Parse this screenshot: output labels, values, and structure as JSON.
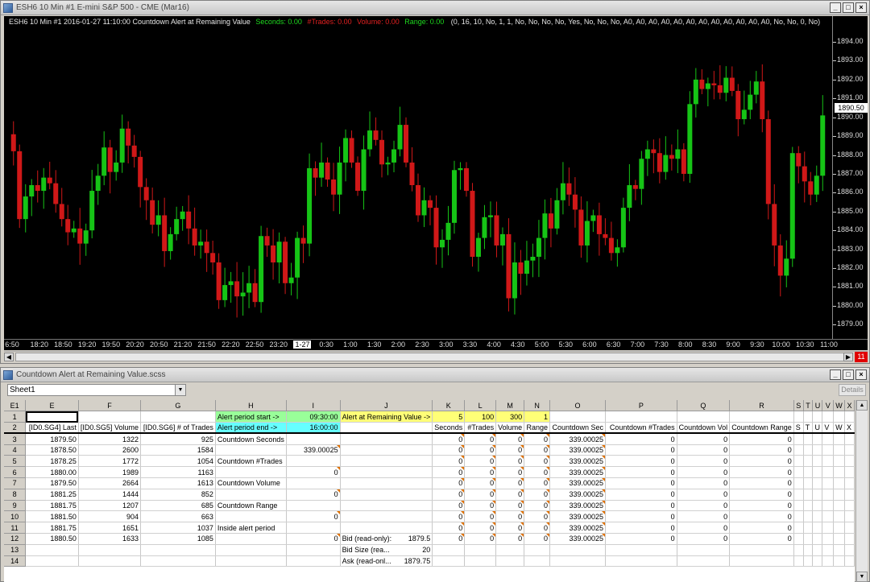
{
  "chart_window": {
    "title": "ESH6  10 Min  #1  E-mini S&P 500 - CME (Mar16)",
    "status_line": "ESH6  10 Min  #1 2016-01-27 11:10:00  Countdown Alert at Remaining Value",
    "status_seconds": "Seconds: 0.00",
    "status_trades": "#Trades: 0.00",
    "status_volume": "Volume: 0.00",
    "status_range": "Range: 0.00",
    "status_params": "(0, 16, 10, No, 1, 1, No, No, No, No, Yes, No, No, No, A0, A0, A0, A0, A0, A0, A0, A0, A0, A0, A0, A0, No, No, 0, No)",
    "current_price": "1890.50",
    "red_badge": "11",
    "colors": {
      "up": "#16c416",
      "down": "#d01818",
      "bg": "#000000",
      "status_green": "#1ed81e",
      "status_red": "#e02020"
    }
  },
  "chart_data": {
    "type": "candlestick",
    "ylim": [
      1878.5,
      1894.6
    ],
    "y_ticks": [
      "1894.00",
      "1893.00",
      "1892.00",
      "1891.00",
      "1890.00",
      "1889.00",
      "1888.00",
      "1887.00",
      "1886.00",
      "1885.00",
      "1884.00",
      "1883.00",
      "1882.00",
      "1881.00",
      "1880.00",
      "1879.00"
    ],
    "x_ticks": [
      "6:50",
      "18:20",
      "18:50",
      "19:20",
      "19:50",
      "20:20",
      "20:50",
      "21:20",
      "21:50",
      "22:20",
      "22:50",
      "23:20",
      "1-27",
      "0:30",
      "1:00",
      "1:30",
      "2:00",
      "2:30",
      "3:00",
      "3:30",
      "4:00",
      "4:30",
      "5:00",
      "5:30",
      "6:00",
      "6:30",
      "7:00",
      "7:30",
      "8:00",
      "8:30",
      "9:00",
      "9:30",
      "10:00",
      "10:30",
      "11:00"
    ],
    "highlight_tick": "1-27",
    "closes": [
      1888.2,
      1884.6,
      1885.8,
      1886.4,
      1886.1,
      1886.8,
      1886.5,
      1885.4,
      1884.6,
      1883.9,
      1884.1,
      1883.3,
      1884.0,
      1886.1,
      1886.9,
      1888.4,
      1887.1,
      1887.6,
      1889.4,
      1888.5,
      1887.9,
      1886.3,
      1885.6,
      1884.3,
      1884.8,
      1882.9,
      1883.8,
      1884.6,
      1885.0,
      1884.1,
      1883.2,
      1883.4,
      1882.8,
      1882.3,
      1880.3,
      1881.1,
      1881.3,
      1880.5,
      1880.7,
      1881.2,
      1880.2,
      1883.7,
      1883.2,
      1882.3,
      1883.4,
      1881.2,
      1881.5,
      1883.6,
      1883.3,
      1887.3,
      1886.8,
      1887.6,
      1886.7,
      1885.9,
      1887.6,
      1888.9,
      1887.6,
      1886.1,
      1888.3,
      1889.3,
      1888.8,
      1887.5,
      1887.6,
      1888.3,
      1889.6,
      1887.6,
      1886.4,
      1884.8,
      1885.6,
      1885.2,
      1883.1,
      1883.5,
      1884.4,
      1887.2,
      1887.3,
      1886.1,
      1882.6,
      1883.6,
      1884.7,
      1884.8,
      1883.2,
      1883.8,
      1880.4,
      1882.3,
      1881.7,
      1882.4,
      1882.6,
      1883.6,
      1884.9,
      1884.1,
      1885.6,
      1886.5,
      1885.9,
      1885.1,
      1883.2,
      1884.5,
      1884.8,
      1883.8,
      1883.6,
      1882.8,
      1883.1,
      1885.2,
      1886.4,
      1886.2,
      1887.8,
      1888.3,
      1888.1,
      1887.1,
      1888.0,
      1887.8,
      1888.3,
      1887.0,
      1890.7,
      1892.0,
      1891.5,
      1891.8,
      1891.7,
      1891.3,
      1892.1,
      1891.4,
      1889.9,
      1890.4,
      1891.2,
      1891.9,
      1889.9,
      1885.4,
      1883.2,
      1881.6,
      1882.5,
      1888.1,
      1887.4,
      1886.6,
      1885.9,
      1886.9,
      1890.1
    ],
    "bar_count": 136
  },
  "sheet_window": {
    "title": "Countdown Alert at Remaining Value.scss",
    "sheet_name": "Sheet1",
    "cell_ref": "E1",
    "details_label": "Details"
  },
  "spreadsheet": {
    "columns": [
      "E",
      "F",
      "G",
      "H",
      "I",
      "J",
      "K",
      "L",
      "M",
      "N",
      "O",
      "P",
      "Q",
      "R",
      "S",
      "T",
      "U",
      "V",
      "W",
      "X"
    ],
    "row1": {
      "h": "Alert period start ->",
      "i": "09:30:00",
      "j": "Alert at Remaining Value ->",
      "k": "5",
      "l": "100",
      "m": "300",
      "n": "1"
    },
    "row2": {
      "e": "[ID0.SG4] Last",
      "f": "[ID0.SG5] Volume",
      "g": "[ID0.SG6]  # of Trades",
      "h": "Alert period end ->",
      "i": "16:00:00",
      "k": "Seconds",
      "l": "#Trades",
      "m": "Volume",
      "n": "Range",
      "o": "Countdown Sec",
      "p": "Countdown #Trades",
      "q": "Countdown Vol",
      "r": "Countdown Range",
      "s": "S",
      "t": "T",
      "u": "U",
      "v": "V",
      "w": "W",
      "x": "X"
    },
    "data_rows": [
      {
        "row": "3",
        "e": "1879.50",
        "f": "1322",
        "g": "925",
        "h": "Countdown Seconds",
        "i": "",
        "j": "",
        "k": "0",
        "l": "0",
        "m": "0",
        "n": "0",
        "o": "339.00025",
        "p": "0",
        "q": "0",
        "r": "0"
      },
      {
        "row": "4",
        "e": "1878.50",
        "f": "2600",
        "g": "1584",
        "h": "",
        "i": "339.00025",
        "j": "",
        "k": "0",
        "l": "0",
        "m": "0",
        "n": "0",
        "o": "339.00025",
        "p": "0",
        "q": "0",
        "r": "0"
      },
      {
        "row": "5",
        "e": "1878.25",
        "f": "1772",
        "g": "1054",
        "h": "Countdown #Trades",
        "i": "",
        "j": "",
        "k": "0",
        "l": "0",
        "m": "0",
        "n": "0",
        "o": "339.00025",
        "p": "0",
        "q": "0",
        "r": "0"
      },
      {
        "row": "6",
        "e": "1880.00",
        "f": "1989",
        "g": "1163",
        "h": "",
        "i": "0",
        "j": "",
        "k": "0",
        "l": "0",
        "m": "0",
        "n": "0",
        "o": "339.00025",
        "p": "0",
        "q": "0",
        "r": "0"
      },
      {
        "row": "7",
        "e": "1879.50",
        "f": "2664",
        "g": "1613",
        "h": "Countdown Volume",
        "i": "",
        "j": "",
        "k": "0",
        "l": "0",
        "m": "0",
        "n": "0",
        "o": "339.00025",
        "p": "0",
        "q": "0",
        "r": "0"
      },
      {
        "row": "8",
        "e": "1881.25",
        "f": "1444",
        "g": "852",
        "h": "",
        "i": "0",
        "j": "",
        "k": "0",
        "l": "0",
        "m": "0",
        "n": "0",
        "o": "339.00025",
        "p": "0",
        "q": "0",
        "r": "0"
      },
      {
        "row": "9",
        "e": "1881.75",
        "f": "1207",
        "g": "685",
        "h": "Countdown Range",
        "i": "",
        "j": "",
        "k": "0",
        "l": "0",
        "m": "0",
        "n": "0",
        "o": "339.00025",
        "p": "0",
        "q": "0",
        "r": "0"
      },
      {
        "row": "10",
        "e": "1881.50",
        "f": "904",
        "g": "663",
        "h": "",
        "i": "0",
        "j": "",
        "k": "0",
        "l": "0",
        "m": "0",
        "n": "0",
        "o": "339.00025",
        "p": "0",
        "q": "0",
        "r": "0"
      },
      {
        "row": "11",
        "e": "1881.75",
        "f": "1651",
        "g": "1037",
        "h": "Inside alert period",
        "i": "",
        "j": "",
        "k": "0",
        "l": "0",
        "m": "0",
        "n": "0",
        "o": "339.00025",
        "p": "0",
        "q": "0",
        "r": "0"
      },
      {
        "row": "12",
        "e": "1880.50",
        "f": "1633",
        "g": "1085",
        "h": "",
        "i": "0",
        "j": "Bid (read-only):",
        "jv": "1879.5",
        "k": "0",
        "l": "0",
        "m": "0",
        "n": "0",
        "o": "339.00025",
        "p": "0",
        "q": "0",
        "r": "0"
      },
      {
        "row": "13",
        "e": "",
        "f": "",
        "g": "",
        "h": "",
        "i": "",
        "j": "Bid Size (rea...",
        "jv": "20",
        "k": "",
        "l": "",
        "m": "",
        "n": "",
        "o": "",
        "p": "",
        "q": "",
        "r": ""
      },
      {
        "row": "14",
        "e": "",
        "f": "",
        "g": "",
        "h": "",
        "i": "",
        "j": "Ask (read-onl...",
        "jv": "1879.75",
        "k": "",
        "l": "",
        "m": "",
        "n": "",
        "o": "",
        "p": "",
        "q": "",
        "r": ""
      }
    ]
  }
}
